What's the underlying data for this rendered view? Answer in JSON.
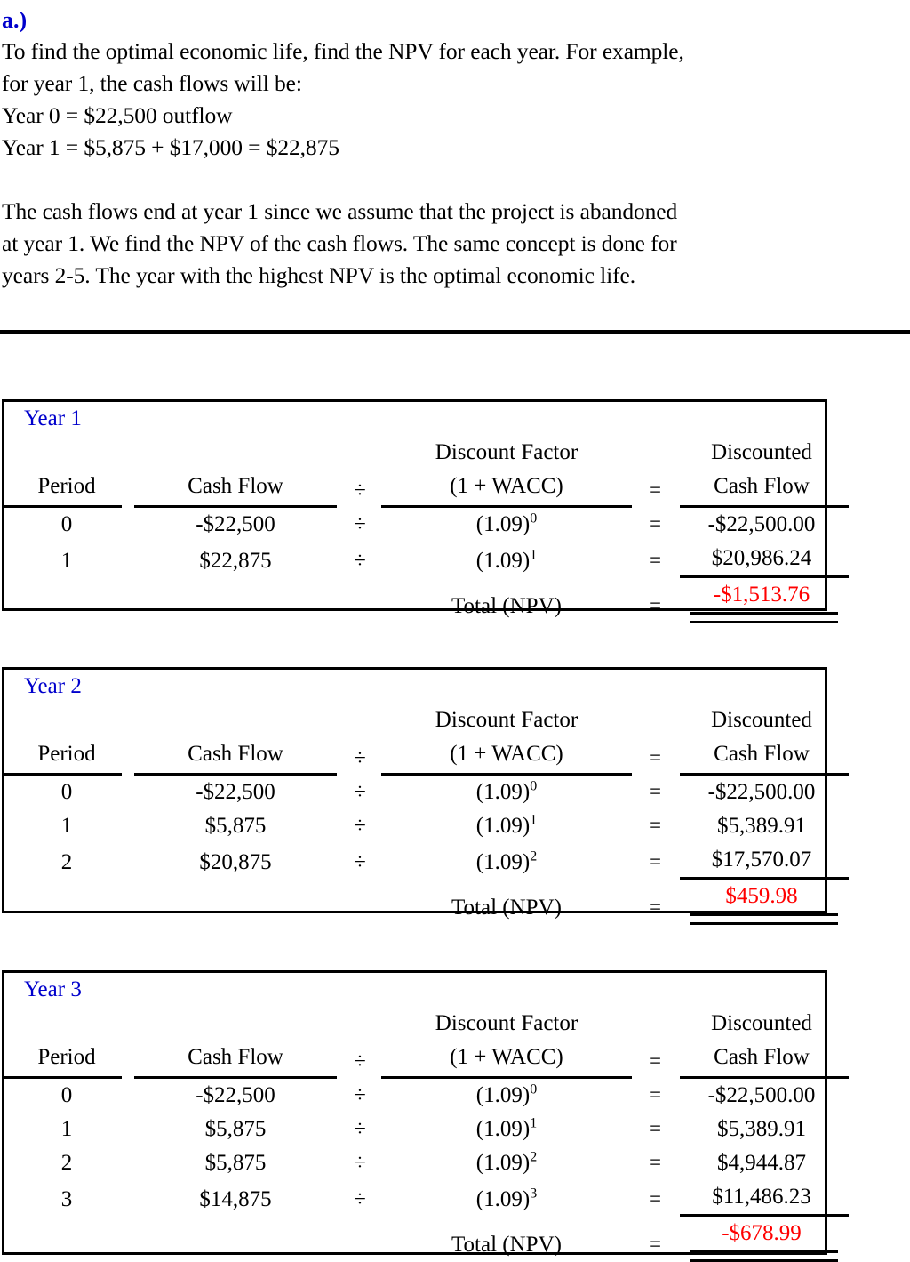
{
  "document": {
    "part_label": "a.)",
    "intro_lines": [
      "To find the optimal economic life, find the NPV for each year.  For example,",
      "for year 1, the cash flows will be:",
      "Year 0 = $22,500 outflow",
      "Year 1 = $5,875 + $17,000 = $22,875"
    ],
    "explanation_lines": [
      "The cash flows end at year 1 since we assume that the project is abandoned",
      "at year 1.  We find the NPV of the cash flows.  The same concept is done for",
      "years 2-5.  The year with the highest NPV is the optimal economic life."
    ]
  },
  "colors": {
    "heading": "#0000cc",
    "npv_negative": "#ff0000",
    "npv_positive": "#ff0000",
    "text": "#000000",
    "rule": "#000000"
  },
  "table_headers": {
    "period": "Period",
    "cash_flow": "Cash Flow",
    "divide": "÷",
    "discount_factor_line1": "Discount Factor",
    "discount_factor_line2": "(1 + WACC)",
    "equals": "=",
    "discounted_line1": "Discounted",
    "discounted_line2": "Cash Flow",
    "total_label": "Total (NPV)"
  },
  "tables": [
    {
      "id": "year-1",
      "label": "Year 1",
      "rows": [
        {
          "period": "0",
          "cash_flow": "-$22,500",
          "div": "÷",
          "base": "(1.09)",
          "exp": "0",
          "eq": "=",
          "discounted": "-$22,500.00"
        },
        {
          "period": "1",
          "cash_flow": "$22,875",
          "div": "÷",
          "base": "(1.09)",
          "exp": "1",
          "eq": "=",
          "discounted": "$20,986.24"
        }
      ],
      "total_label": "Total (NPV)",
      "total_eq": "=",
      "npv": "-$1,513.76",
      "npv_color": "#ff0000"
    },
    {
      "id": "year-2",
      "label": "Year 2",
      "rows": [
        {
          "period": "0",
          "cash_flow": "-$22,500",
          "div": "÷",
          "base": "(1.09)",
          "exp": "0",
          "eq": "=",
          "discounted": "-$22,500.00"
        },
        {
          "period": "1",
          "cash_flow": "$5,875",
          "div": "÷",
          "base": "(1.09)",
          "exp": "1",
          "eq": "=",
          "discounted": "$5,389.91"
        },
        {
          "period": "2",
          "cash_flow": "$20,875",
          "div": "÷",
          "base": "(1.09)",
          "exp": "2",
          "eq": "=",
          "discounted": "$17,570.07"
        }
      ],
      "total_label": "Total (NPV)",
      "total_eq": "=",
      "npv": "$459.98",
      "npv_color": "#ff0000"
    },
    {
      "id": "year-3",
      "label": "Year 3",
      "rows": [
        {
          "period": "0",
          "cash_flow": "-$22,500",
          "div": "÷",
          "base": "(1.09)",
          "exp": "0",
          "eq": "=",
          "discounted": "-$22,500.00"
        },
        {
          "period": "1",
          "cash_flow": "$5,875",
          "div": "÷",
          "base": "(1.09)",
          "exp": "1",
          "eq": "=",
          "discounted": "$5,389.91"
        },
        {
          "period": "2",
          "cash_flow": "$5,875",
          "div": "÷",
          "base": "(1.09)",
          "exp": "2",
          "eq": "=",
          "discounted": "$4,944.87"
        },
        {
          "period": "3",
          "cash_flow": "$14,875",
          "div": "÷",
          "base": "(1.09)",
          "exp": "3",
          "eq": "=",
          "discounted": "$11,486.23"
        }
      ],
      "total_label": "Total (NPV)",
      "total_eq": "=",
      "npv": "-$678.99",
      "npv_color": "#ff0000"
    }
  ]
}
